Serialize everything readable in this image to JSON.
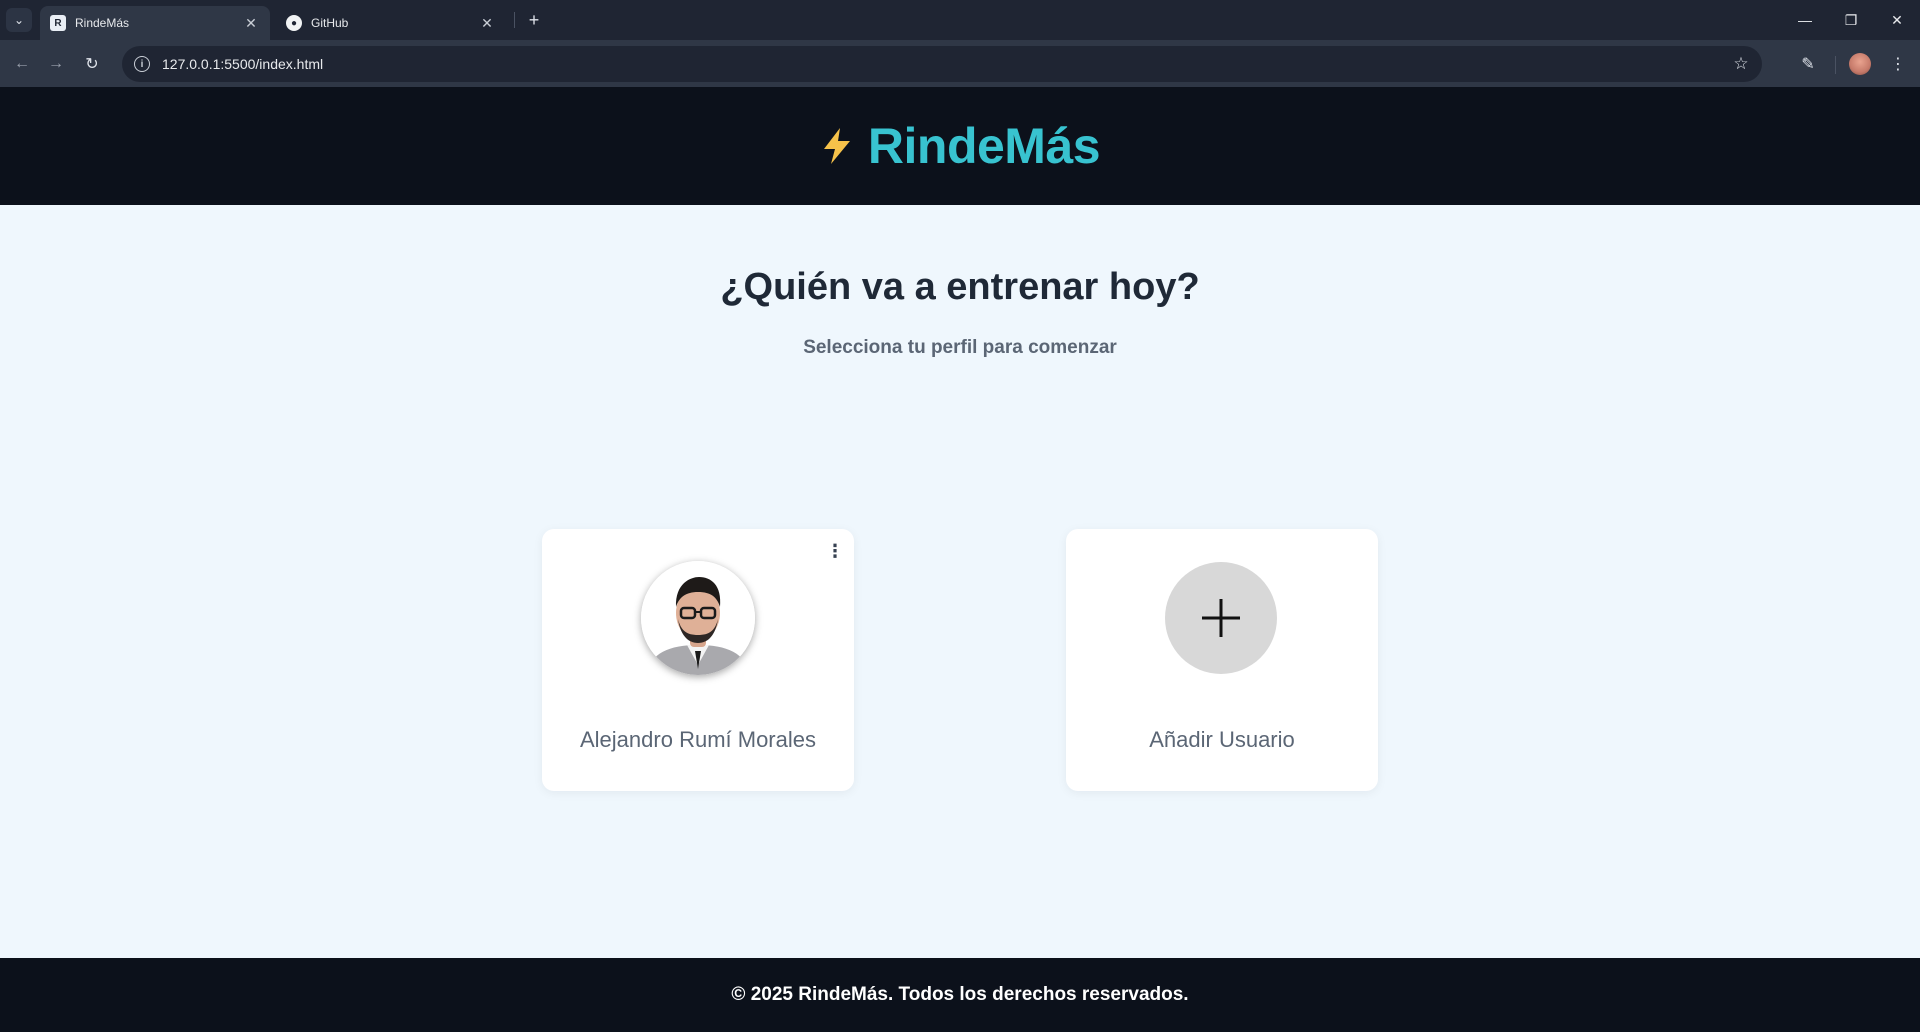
{
  "browser": {
    "tabs": [
      {
        "title": "RindeMás",
        "active": true
      },
      {
        "title": "GitHub",
        "active": false
      }
    ],
    "url": "127.0.0.1:5500/index.html"
  },
  "header": {
    "brand_name": "RindeMás",
    "accent_color": "#38c3d0",
    "bolt_color": "#f6c24a"
  },
  "main": {
    "title": "¿Quién va a entrenar hoy?",
    "subtitle": "Selecciona tu perfil para comenzar",
    "profiles": [
      {
        "name": "Alejandro Rumí Morales"
      }
    ],
    "add_user_label": "Añadir Usuario"
  },
  "footer": {
    "text": "© 2025 RindeMás. Todos los derechos reservados."
  },
  "icons": [
    "tab-list-icon",
    "close-icon",
    "plus-icon",
    "back-icon",
    "forward-icon",
    "reload-icon",
    "info-icon",
    "star-icon",
    "extensions-icon",
    "kebab-menu-icon",
    "bolt-icon"
  ]
}
